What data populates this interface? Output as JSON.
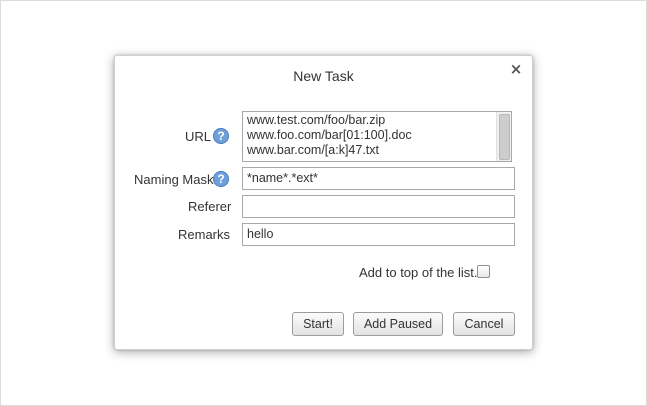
{
  "dialog": {
    "title": "New Task",
    "close_glyph": "×"
  },
  "form": {
    "url": {
      "label": "URL",
      "help_glyph": "?",
      "lines": [
        "www.test.com/foo/bar.zip",
        "www.foo.com/bar[01:100].doc",
        "www.bar.com/[a:k]47.txt"
      ]
    },
    "naming_mask": {
      "label": "Naming Mask",
      "help_glyph": "?",
      "value": "*name*.*ext*"
    },
    "referer": {
      "label": "Referer",
      "value": ""
    },
    "remarks": {
      "label": "Remarks",
      "value": "hello"
    },
    "add_to_top": {
      "label": "Add to top of the list.",
      "checked": false
    }
  },
  "buttons": {
    "start": "Start!",
    "add_paused": "Add Paused",
    "cancel": "Cancel"
  },
  "icons": {
    "help": "help-icon",
    "close": "close-icon"
  },
  "colors": {
    "help_icon": "#6f9fd8",
    "dialog_border": "#d0d0d0",
    "input_border": "#a9a9a9"
  }
}
